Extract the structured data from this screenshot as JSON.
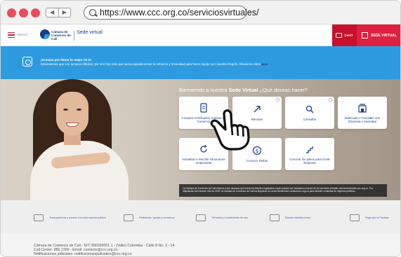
{
  "browser": {
    "url": "https://www.ccc.org.co/serviciosvirtuales/",
    "back_glyph": "◀",
    "forward_glyph": "▶"
  },
  "header": {
    "menu_label": "MENÚ",
    "logo_text": "Cámara de Comercio de Cali",
    "sede_text": "Sede virtual",
    "chat_label": "CHAT",
    "sede_button_label": "SEDE VIRTUAL",
    "accent_color": "#e02040"
  },
  "banner": {
    "title": "¡Gracias por llenar lo mejor de ti!",
    "text": "Entendemos que son tiempos difíciles, por eso hoy más que nunca agradecemos tu esfuerzo y tenacidad para hacer equipo por nuestra Región. Obsesrva video",
    "link": "aquí",
    "color": "#2e9be0"
  },
  "hero": {
    "title_prefix": "Bienvenido a nuestra ",
    "title_bold": "Sede Virtual",
    "title_suffix": " ¿Qué deseas hacer?",
    "services": [
      {
        "label": "Comprar Certificados Cámara de Comercio",
        "icon": "document-icon"
      },
      {
        "label": "Renovar",
        "icon": "rocket-icon"
      },
      {
        "label": "Consultar",
        "icon": "search-icon"
      },
      {
        "label": "Matricular o Constituir una Empresa o Sociedad",
        "icon": "building-icon"
      },
      {
        "label": "Actualizar e inscribir información empresarial",
        "icon": "refresh-icon"
      },
      {
        "label": "Conocer Tarifas",
        "icon": "dollar-icon"
      },
      {
        "label": "Conocer los pasos para Crear Empresa",
        "icon": "steps-icon"
      }
    ],
    "info_text": "La Cámara de Comercio de Cali informa a sus usuarios que todos los trámites registrales cuyas puedan ser radicados a través de los servicios virtuales serviciosvirtuales.ccc.org.co. Por disposición del Decreto 434 de 2020, la Cámara de Comercio de Cali ha dispuesto el correo electrónico contactoccc.org.co para atender consultas de registros públicos."
  },
  "strip": {
    "items": [
      {
        "label": "Transparencia y acceso a la información pública",
        "icon": "scale-icon"
      },
      {
        "label": "Peticiones, quejas y reclamos",
        "icon": "monitor-icon"
      },
      {
        "label": "Términos y condiciones de uso",
        "icon": "hand-icon"
      },
      {
        "label": "Estado trámites línea",
        "icon": "building-icon"
      },
      {
        "label": "Pago por la Factura",
        "icon": "dollar-icon"
      }
    ]
  },
  "footer": {
    "line1": "Cámara de Comercio de Cali - NIT: 890399001-1 - (Valle) Colombia - Calle 8 No. 3 - 14",
    "line2": "Call Center: 886 1300 - Email: contacto@ccc.org.co -",
    "line3": "Notificaciones judiciales: notificacionesjudiciales@ccc.org.co"
  }
}
